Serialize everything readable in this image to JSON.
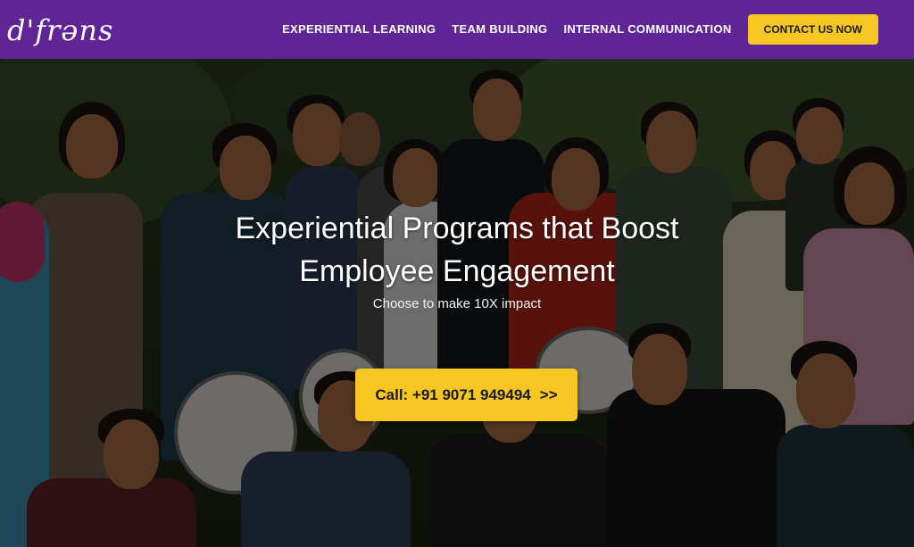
{
  "brand": {
    "logo_text": "d'frǝns"
  },
  "nav": {
    "items": [
      {
        "label": "EXPERIENTIAL LEARNING"
      },
      {
        "label": "TEAM BUILDING"
      },
      {
        "label": "INTERNAL COMMUNICATION"
      }
    ],
    "cta_label": "CONTACT US NOW"
  },
  "hero": {
    "title_line1": "Experiential Programs that Boost",
    "title_line2": "Employee Engagement",
    "subtitle": "Choose to make 10X impact",
    "call_label": "Call: +91 9071 949494",
    "call_arrows": ">>"
  },
  "colors": {
    "header_bg": "#5f2495",
    "accent_yellow": "#f6c623"
  }
}
